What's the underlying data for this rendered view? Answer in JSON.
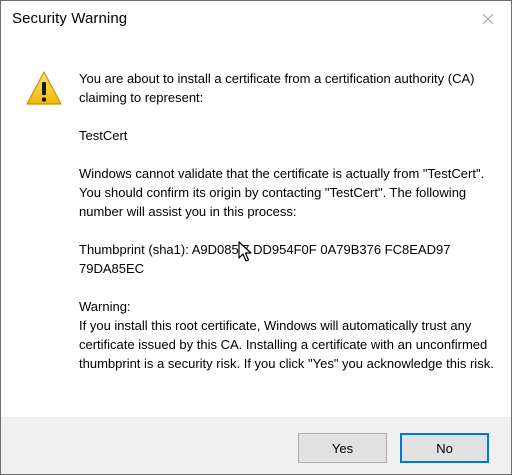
{
  "window": {
    "title": "Security Warning"
  },
  "message": {
    "intro": "You are about to install a certificate from a certification authority (CA) claiming to represent:",
    "ca_name": "TestCert",
    "validation": "Windows cannot validate that the certificate is actually from \"TestCert\". You should confirm its origin by contacting \"TestCert\". The following number will assist you in this process:",
    "thumbprint": "Thumbprint (sha1): A9D085 7 DD954F0F 0A79B376 FC8EAD97 79DA85EC",
    "warning_heading": "Warning:",
    "warning_body": "If you install this root certificate, Windows will automatically trust any certificate issued by this CA. Installing a certificate with an unconfirmed thumbprint is a security risk. If you click \"Yes\" you acknowledge this risk."
  },
  "buttons": {
    "yes_label": "Yes",
    "no_label": "No"
  },
  "icons": {
    "warning": "warning-icon",
    "close": "close-icon",
    "cursor": "mouse-cursor-icon"
  },
  "colors": {
    "warning_yellow": "#f5c211",
    "focus_blue": "#0078d7",
    "footer_bg": "#f0f0f0"
  }
}
